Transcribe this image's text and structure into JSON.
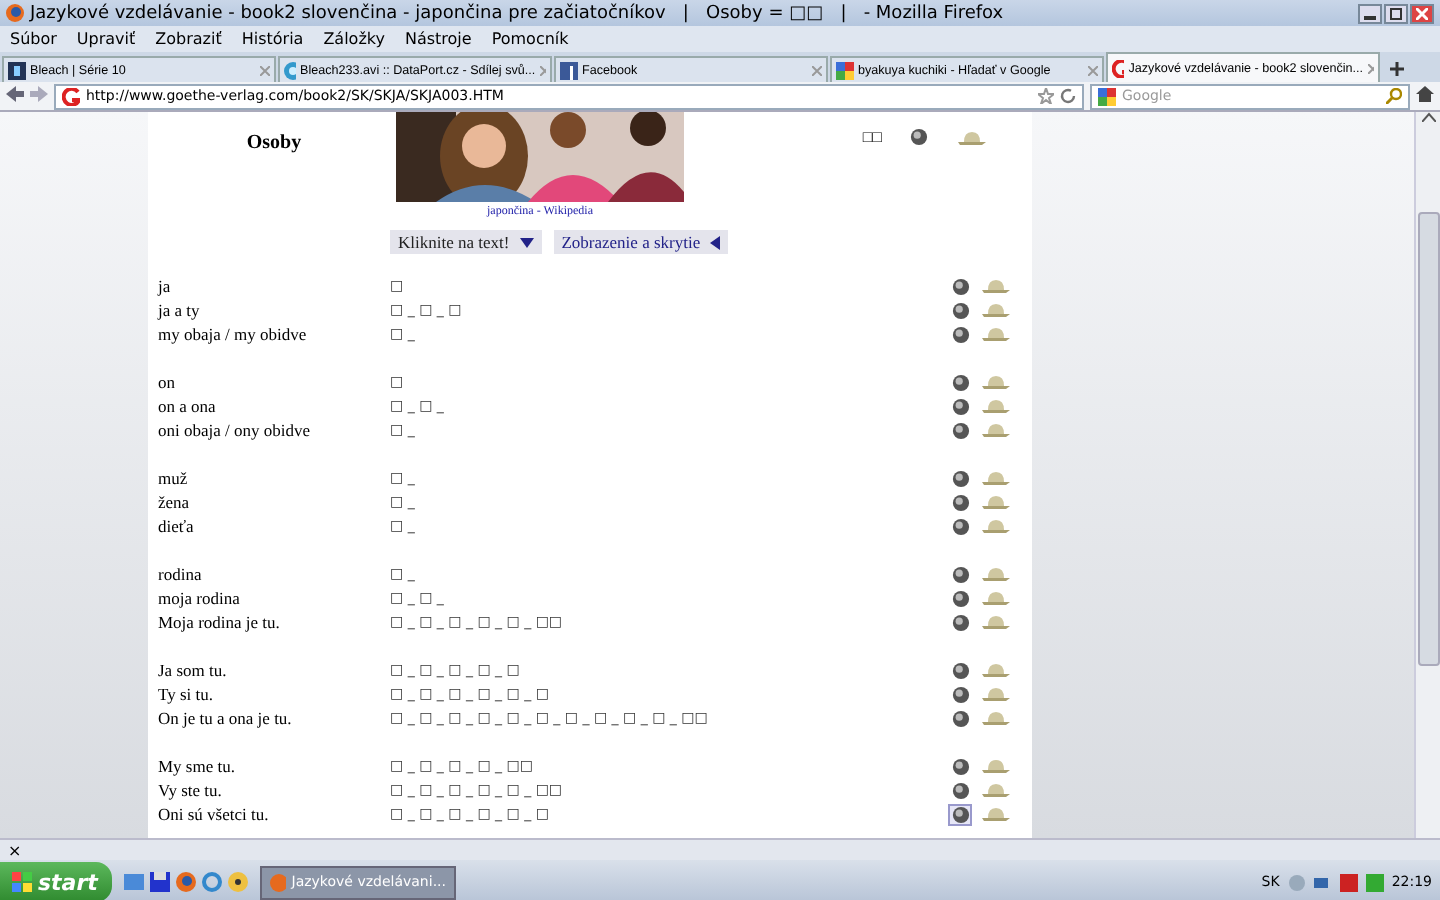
{
  "window": {
    "title": "Jazykové vzdelávanie - book2 slovenčina - japončina pre začiatočníkov   |   Osoby = □□   |   - Mozilla Firefox"
  },
  "menu": [
    "Súbor",
    "Upraviť",
    "Zobraziť",
    "História",
    "Záložky",
    "Nástroje",
    "Pomocník"
  ],
  "tabs": [
    {
      "label": "Bleach | Série 10",
      "selected": false,
      "kind": "bleach"
    },
    {
      "label": "Bleach233.avi :: DataPort.cz - Sdílej svů...",
      "selected": false,
      "kind": "globe"
    },
    {
      "label": "Facebook",
      "selected": false,
      "kind": "facebook"
    },
    {
      "label": "byakuya kuchiki - Hľadať v Google",
      "selected": false,
      "kind": "google"
    },
    {
      "label": "Jazykové vzdelávanie - book2 slovenčin...",
      "selected": true,
      "kind": "goethe"
    }
  ],
  "address": {
    "url": "http://www.goethe-verlag.com/book2/SK/SKJA/SKJA003.HTM"
  },
  "search": {
    "placeholder": "Google"
  },
  "page": {
    "heading": "Osoby",
    "code": "□□",
    "caption": "japončina - Wikipedia",
    "buttons": [
      {
        "label": "Kliknite na text!",
        "kind": "down"
      },
      {
        "label": "Zobrazenie a skrytie",
        "kind": "left"
      }
    ],
    "groups": [
      {
        "rows": [
          {
            "slovak": "ja",
            "japanese": "□",
            "selected": false
          },
          {
            "slovak": "ja a ty",
            "japanese": "□ _ □ _ □",
            "selected": false
          },
          {
            "slovak": "my obaja / my obidve",
            "japanese": "□ _",
            "selected": false
          }
        ]
      },
      {
        "rows": [
          {
            "slovak": "on",
            "japanese": "□",
            "selected": false
          },
          {
            "slovak": "on a ona",
            "japanese": "□ _ □ _",
            "selected": false
          },
          {
            "slovak": "oni obaja / ony obidve",
            "japanese": "□ _",
            "selected": false
          }
        ]
      },
      {
        "rows": [
          {
            "slovak": "muž",
            "japanese": "□ _",
            "selected": false
          },
          {
            "slovak": "žena",
            "japanese": "□ _",
            "selected": false
          },
          {
            "slovak": "dieťa",
            "japanese": "□ _",
            "selected": false
          }
        ]
      },
      {
        "rows": [
          {
            "slovak": "rodina",
            "japanese": "□ _",
            "selected": false
          },
          {
            "slovak": "moja rodina",
            "japanese": "□ _ □ _",
            "selected": false
          },
          {
            "slovak": "Moja rodina je tu.",
            "japanese": "□ _ □ _ □ _ □ _ □ _ □□",
            "selected": false
          }
        ]
      },
      {
        "rows": [
          {
            "slovak": "Ja som tu.",
            "japanese": "□ _ □ _ □ _ □ _ □",
            "selected": false
          },
          {
            "slovak": "Ty si tu.",
            "japanese": "□ _ □ _ □ _ □ _ □ _ □",
            "selected": false
          },
          {
            "slovak": "On je tu a ona je tu.",
            "japanese": "□ _ □ _ □ _ □ _ □ _ □ _ □ _ □ _ □ _ □ _ □□",
            "selected": false
          }
        ]
      },
      {
        "rows": [
          {
            "slovak": "My sme tu.",
            "japanese": "□ _ □ _ □ _ □ _ □□",
            "selected": false
          },
          {
            "slovak": "Vy ste tu.",
            "japanese": "□ _ □ _ □ _ □ _ □ _ □□",
            "selected": false
          },
          {
            "slovak": "Oni sú všetci tu.",
            "japanese": "□ _ □ _ □ _ □ _ □ _ □",
            "selected": true
          }
        ]
      }
    ]
  },
  "status": {
    "close": "×"
  },
  "taskbar": {
    "start": "start",
    "task": "Jazykové vzdelávani...",
    "language": "SK",
    "clock": "22:19"
  }
}
